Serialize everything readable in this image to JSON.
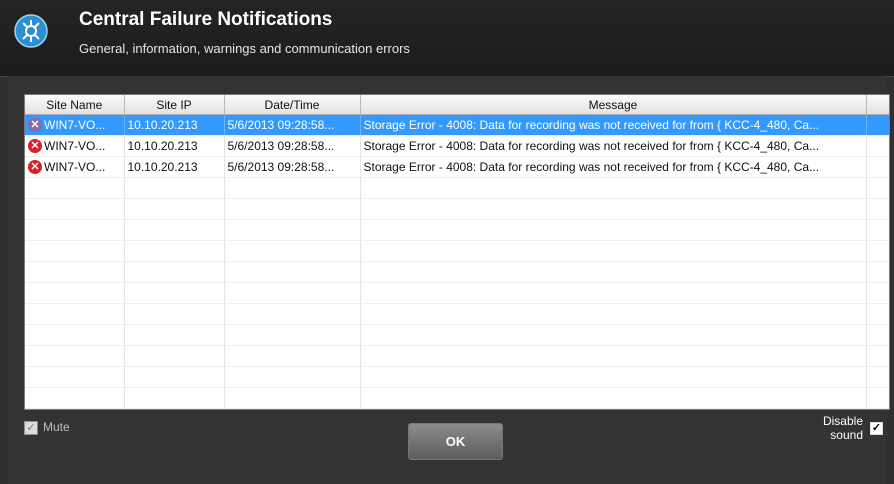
{
  "header": {
    "title": "Central Failure Notifications",
    "subtitle": "General, information, warnings and communication errors"
  },
  "columns": [
    "Site Name",
    "Site IP",
    "Date/Time",
    "Message"
  ],
  "rows": [
    {
      "site": "WIN7-VO...",
      "ip": "10.10.20.213",
      "datetime": "5/6/2013  09:28:58...",
      "message": "Storage Error - 4008: Data for recording was not received for from { KCC-4_480, Ca...",
      "selected": true
    },
    {
      "site": "WIN7-VO...",
      "ip": "10.10.20.213",
      "datetime": "5/6/2013  09:28:58...",
      "message": "Storage Error - 4008: Data for recording was not received for from { KCC-4_480, Ca...",
      "selected": false
    },
    {
      "site": "WIN7-VO...",
      "ip": "10.10.20.213",
      "datetime": "5/6/2013  09:28:58...",
      "message": "Storage Error - 4008: Data for recording was not received for from { KCC-4_480, Ca...",
      "selected": false
    }
  ],
  "mute": {
    "label": "Mute",
    "checked": true
  },
  "ok_label": "OK",
  "disable_sound": {
    "label_line1": "Disable",
    "label_line2": "sound",
    "checked": true
  },
  "colors": {
    "selection": "#3399ff",
    "error": "#d92027",
    "header_bg": "#1c1c1c"
  },
  "icons": {
    "app": "satellite-dish-icon",
    "row": "error-x-circle-icon"
  }
}
